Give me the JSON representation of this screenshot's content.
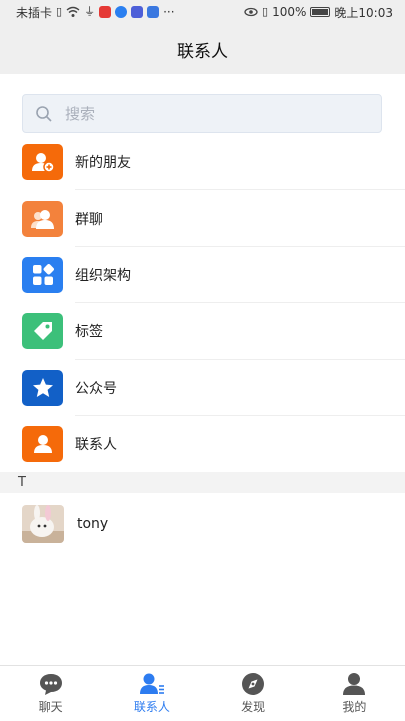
{
  "status_bar": {
    "carrier": "未插卡",
    "battery_percent": "100%",
    "time": "晚上10:03",
    "more": "···"
  },
  "header": {
    "title": "联系人"
  },
  "search": {
    "placeholder": "搜索"
  },
  "menu": [
    {
      "label": "新的朋友",
      "icon": "add-friend-icon",
      "color": "#f56a0a"
    },
    {
      "label": "群聊",
      "icon": "group-chat-icon",
      "color": "#f3823c"
    },
    {
      "label": "组织架构",
      "icon": "organization-icon",
      "color": "#2a7ff0"
    },
    {
      "label": "标签",
      "icon": "tag-icon",
      "color": "#3cc07a"
    },
    {
      "label": "公众号",
      "icon": "star-icon",
      "color": "#1260c7"
    },
    {
      "label": "联系人",
      "icon": "contact-icon",
      "color": "#f56a0a"
    }
  ],
  "section": {
    "letter": "T"
  },
  "contacts": [
    {
      "name": "tony"
    }
  ],
  "tabbar": {
    "active_color": "#2d7cf0",
    "tabs": [
      {
        "label": "聊天",
        "icon": "chat-icon"
      },
      {
        "label": "联系人",
        "icon": "contacts-icon",
        "active": true
      },
      {
        "label": "发现",
        "icon": "compass-icon"
      },
      {
        "label": "我的",
        "icon": "profile-icon"
      }
    ]
  }
}
